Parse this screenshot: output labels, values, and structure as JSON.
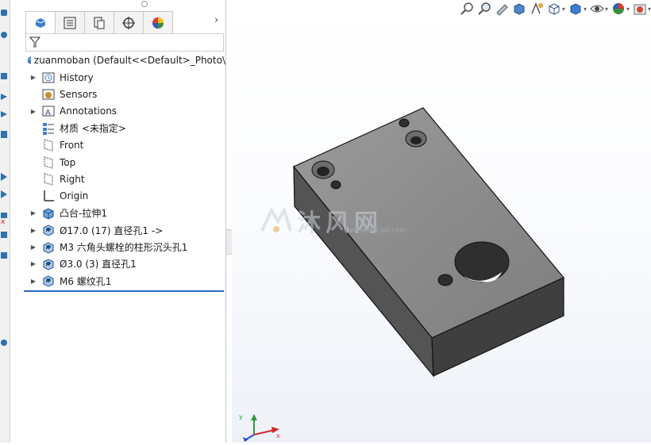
{
  "feature_manager": {
    "root_label": "zuanmoban  (Default<<Default>_Photo\\",
    "nodes": [
      {
        "label": "History",
        "expand": true,
        "icon": "history-icon"
      },
      {
        "label": "Sensors",
        "expand": false,
        "icon": "sensor-icon"
      },
      {
        "label": "Annotations",
        "expand": true,
        "icon": "annotations-icon"
      },
      {
        "label": "材质 <未指定>",
        "expand": false,
        "icon": "material-icon"
      },
      {
        "label": "Front",
        "expand": false,
        "icon": "plane-icon"
      },
      {
        "label": "Top",
        "expand": false,
        "icon": "plane-icon"
      },
      {
        "label": "Right",
        "expand": false,
        "icon": "plane-icon"
      },
      {
        "label": "Origin",
        "expand": false,
        "icon": "origin-icon"
      },
      {
        "label": "凸台-拉伸1",
        "expand": true,
        "icon": "extrude-icon"
      },
      {
        "label": "Ø17.0 (17) 直径孔1 ->",
        "expand": true,
        "icon": "hole-wizard-icon"
      },
      {
        "label": "M3 六角头螺栓的柱形沉头孔1",
        "expand": true,
        "icon": "hole-wizard-icon"
      },
      {
        "label": "Ø3.0 (3) 直径孔1",
        "expand": true,
        "icon": "hole-wizard-icon"
      },
      {
        "label": "M6 螺纹孔1",
        "expand": true,
        "icon": "hole-wizard-icon"
      }
    ]
  },
  "watermark": {
    "text": "沐风网",
    "url": "www.mfcad.com"
  },
  "colors": {
    "accent": "#2b6ac8",
    "part_top": "#8c8c8c",
    "part_side": "#4a4a4a"
  }
}
